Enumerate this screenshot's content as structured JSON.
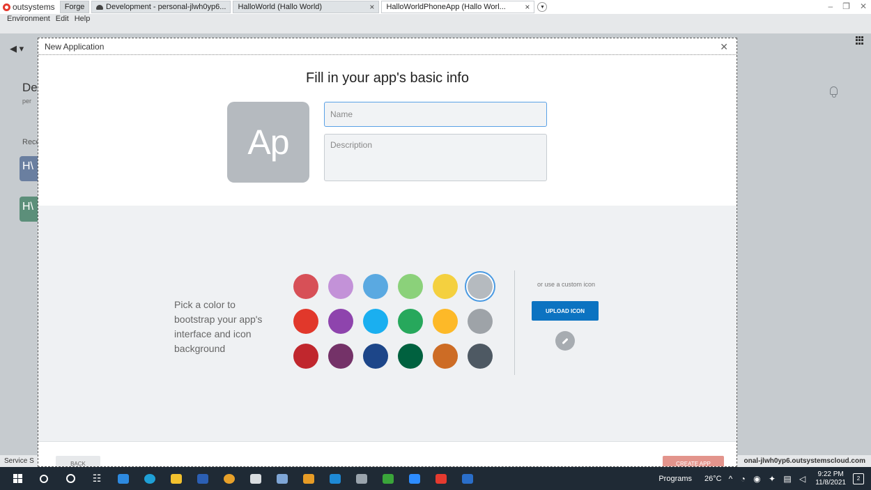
{
  "tabs": {
    "brand": "outsystems",
    "items": [
      {
        "label": "Forge"
      },
      {
        "label": "Development - personal-jlwh0yp6..."
      },
      {
        "label": "HalloWorld (Hallo World)"
      },
      {
        "label": "HalloWorldPhoneApp (Hallo Worl..."
      }
    ]
  },
  "menu": [
    "Environment",
    "Edit",
    "Help"
  ],
  "background": {
    "title": "De",
    "subtitle": "per",
    "recent": "Rece",
    "tile1": "H\\",
    "tile2": "H\\",
    "status_left": "Service S",
    "status_right": "onal-jlwh0yp6.outsystemscloud.com"
  },
  "dialog": {
    "header": "New Application",
    "title": "Fill in your app's basic info",
    "icon_text": "Ap",
    "name_placeholder": "Name",
    "description_placeholder": "Description",
    "pick_text": "Pick a color to bootstrap your app's interface and icon background",
    "custom_text": "or use a custom icon",
    "upload_label": "UPLOAD ICON",
    "back_label": "BACK",
    "create_label": "CREATE APP",
    "colors": [
      [
        "#d75057",
        "#c392d8",
        "#5aa9e1",
        "#8bd17a",
        "#f4d03f",
        "#b5babf"
      ],
      [
        "#e1382b",
        "#8e44ad",
        "#1aaff0",
        "#27a85c",
        "#fdb928",
        "#9ea3a8"
      ],
      [
        "#c0272d",
        "#743268",
        "#1d4689",
        "#00613f",
        "#cd6c25",
        "#4e5963"
      ]
    ],
    "selected_color": "#b5babf"
  },
  "taskbar": {
    "programs_label": "Programs",
    "temperature": "26°C",
    "time": "9:22 PM",
    "date": "11/8/2021",
    "notif_count": "2"
  }
}
